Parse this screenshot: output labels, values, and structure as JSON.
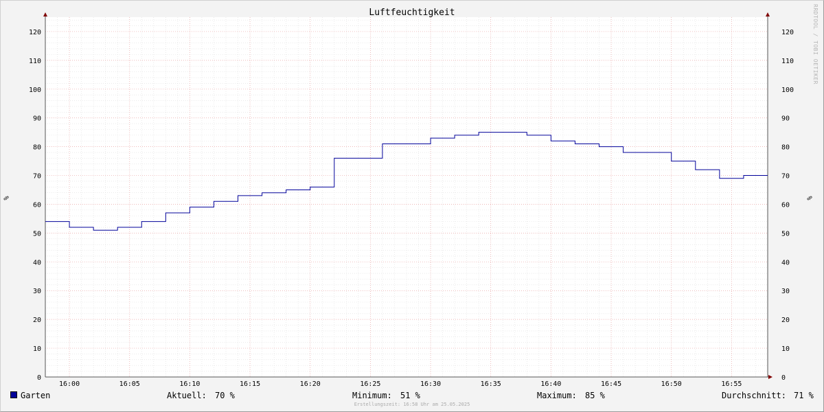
{
  "header": {
    "title": "Luftfeuchtigkeit",
    "watermark": "RRDTOOL / TOBI OETIKER"
  },
  "axes": {
    "y_unit_left": "%",
    "y_unit_right": "%"
  },
  "legend": {
    "series_name": "Garten",
    "current_label": "Aktuell:",
    "current_value": "70 %",
    "min_label": "Minimum:",
    "min_value": "51 %",
    "max_label": "Maximum:",
    "max_value": "85 %",
    "avg_label": "Durchschnitt:",
    "avg_value": "71 %",
    "swatch_color": "#000099"
  },
  "footer": {
    "text": "Erstellungszeit: 16:58 Uhr am 25.05.2025"
  },
  "chart_data": {
    "type": "line",
    "title": "Luftfeuchtigkeit",
    "xlabel": "",
    "ylabel": "%",
    "ylim": [
      0,
      125
    ],
    "xlim": [
      "15:58",
      "16:58"
    ],
    "yticks": [
      0,
      10,
      20,
      30,
      40,
      50,
      60,
      70,
      80,
      90,
      100,
      110,
      120
    ],
    "xticks": [
      "16:00",
      "16:05",
      "16:10",
      "16:15",
      "16:20",
      "16:25",
      "16:30",
      "16:35",
      "16:40",
      "16:45",
      "16:50",
      "16:55"
    ],
    "grid": true,
    "legend_position": "bottom",
    "series": [
      {
        "name": "Garten",
        "color": "#000099",
        "step": true,
        "x": [
          "15:58",
          "16:00",
          "16:02",
          "16:04",
          "16:06",
          "16:08",
          "16:10",
          "16:12",
          "16:14",
          "16:16",
          "16:18",
          "16:20",
          "16:22",
          "16:24",
          "16:26",
          "16:28",
          "16:30",
          "16:32",
          "16:34",
          "16:36",
          "16:38",
          "16:40",
          "16:42",
          "16:44",
          "16:46",
          "16:48",
          "16:50",
          "16:52",
          "16:54",
          "16:56"
        ],
        "values": [
          54,
          52,
          51,
          52,
          54,
          57,
          59,
          61,
          63,
          64,
          65,
          66,
          76,
          76,
          81,
          81,
          83,
          84,
          85,
          85,
          84,
          82,
          81,
          80,
          78,
          78,
          75,
          72,
          69,
          70
        ]
      }
    ]
  }
}
